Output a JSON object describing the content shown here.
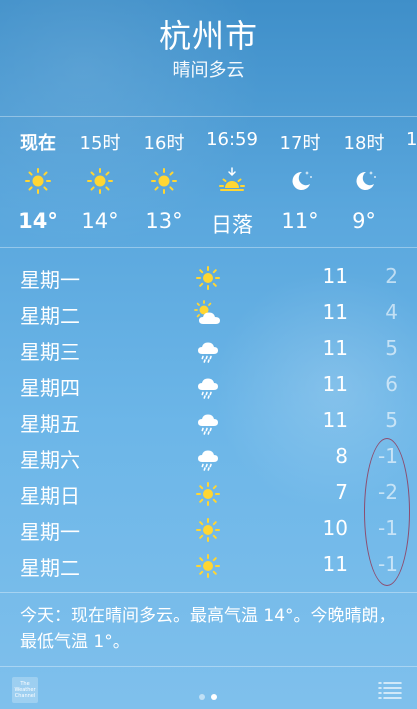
{
  "location": {
    "city": "杭州市",
    "condition": "晴间多云"
  },
  "hourly": [
    {
      "time": "现在",
      "icon": "sun-icon",
      "temp": "14°"
    },
    {
      "time": "15时",
      "icon": "sun-icon",
      "temp": "14°"
    },
    {
      "time": "16时",
      "icon": "sun-icon",
      "temp": "13°"
    },
    {
      "time": "16:59",
      "icon": "sunset-icon",
      "temp": "日落"
    },
    {
      "time": "17时",
      "icon": "moon-icon",
      "temp": "11°"
    },
    {
      "time": "18时",
      "icon": "moon-icon",
      "temp": "9°"
    },
    {
      "time": "1"
    }
  ],
  "daily": [
    {
      "day": "星期一",
      "icon": "sun-icon",
      "high": "11",
      "low": "2"
    },
    {
      "day": "星期二",
      "icon": "partly-cloudy-icon",
      "high": "11",
      "low": "4"
    },
    {
      "day": "星期三",
      "icon": "rain-cloud-icon",
      "high": "11",
      "low": "5"
    },
    {
      "day": "星期四",
      "icon": "rain-cloud-icon",
      "high": "11",
      "low": "6"
    },
    {
      "day": "星期五",
      "icon": "rain-cloud-icon",
      "high": "11",
      "low": "5"
    },
    {
      "day": "星期六",
      "icon": "rain-cloud-icon",
      "high": "8",
      "low": "-1"
    },
    {
      "day": "星期日",
      "icon": "sun-icon",
      "high": "7",
      "low": "-2"
    },
    {
      "day": "星期一",
      "icon": "sun-icon",
      "high": "10",
      "low": "-1"
    },
    {
      "day": "星期二",
      "icon": "sun-icon",
      "high": "11",
      "low": "-1"
    }
  ],
  "summary": "今天：现在晴间多云。最高气温 14°。今晚晴朗，最低气温 1°。",
  "footer": {
    "twc_logo": "The Weather Channel",
    "page_count": 2,
    "active_page": 2
  },
  "colors": {
    "background_top": "#3f8fc9",
    "background_bottom": "#7fc0ec",
    "sun": "#ffd633",
    "annotation": "#962846"
  }
}
